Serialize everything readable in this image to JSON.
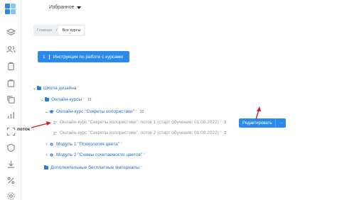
{
  "sidebar": {
    "icons": [
      "layers-icon",
      "users-icon",
      "clipboard-icon",
      "cart-icon",
      "copy-icon",
      "bar-chart-icon",
      "scan-icon",
      "shield-icon",
      "download-icon",
      "percent-icon",
      "settings-icon"
    ],
    "accent": "#2a8ae9"
  },
  "header": {
    "favorites_label": "Избранное"
  },
  "breadcrumb": {
    "home": "Главная",
    "separator": "/",
    "current": "Все курсы"
  },
  "guide_button": {
    "count": "1",
    "label": "Инструкция по работе с курсами"
  },
  "tree": {
    "school": {
      "label": "Школа дизайна",
      "mark": "⁺⁄"
    },
    "online_courses": {
      "label": "Онлайн-курсы",
      "mark": "⁺⁄",
      "count": "13"
    },
    "course": {
      "label": "Онлайн-курс \"Секреты колористики\"",
      "mark": "⁺⁄",
      "count": "10"
    },
    "stream1": {
      "label": "Онлайн-курс \"Секреты колористики\", поток 1 (старт обучения: 01.08.2022)",
      "mark": "⁺⁄",
      "count": "2"
    },
    "stream2": {
      "label": "Онлайн-курс \"Секреты колористики\", поток 2 (старт обучения: 01.09.2022)",
      "mark": "⁺⁄",
      "count": "2"
    },
    "module1": {
      "label": "Модуль 1 \"Психология цвета\"",
      "mark": "⁺⁄"
    },
    "module2": {
      "label": "Модуль 2 \"Схемы сочетаемости цветов\"",
      "mark": "⁺⁄"
    },
    "extra": {
      "label": "Дополнительные бесплатные материалы",
      "mark": "⁺⁄"
    }
  },
  "edit_button": {
    "label": "Редактировать",
    "more": "···"
  },
  "annotation": {
    "label": "поток",
    "color": "#d7192a"
  }
}
